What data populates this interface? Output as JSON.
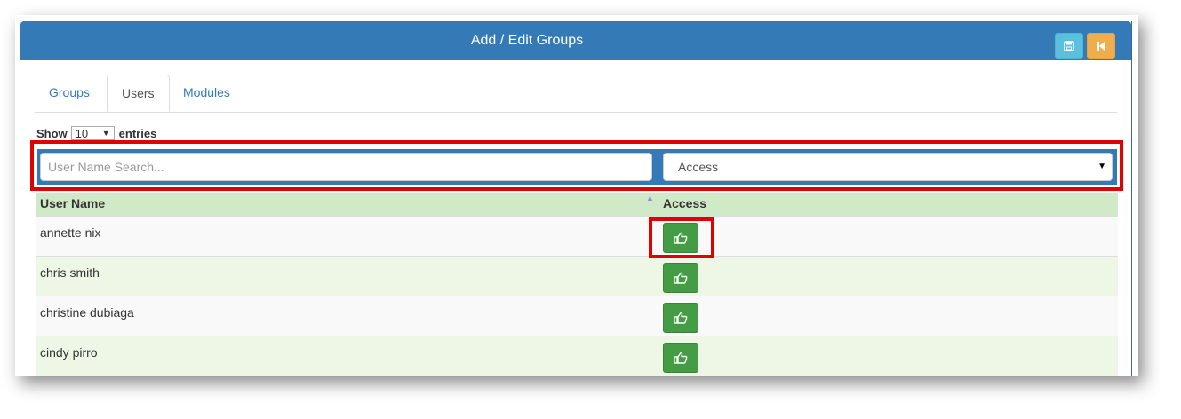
{
  "header": {
    "title": "Add / Edit Groups",
    "save_icon": "floppy-disk-icon",
    "back_icon": "step-backward-icon",
    "colors": {
      "header": "#337ab7",
      "save": "#5bc0de",
      "back": "#f0ad4e"
    }
  },
  "tabs": [
    {
      "label": "Groups",
      "active": false
    },
    {
      "label": "Users",
      "active": true
    },
    {
      "label": "Modules",
      "active": false
    }
  ],
  "length": {
    "show_label": "Show",
    "value": "10",
    "entries_label": "entries"
  },
  "filters": {
    "search_placeholder": "User Name Search...",
    "access_value": "Access"
  },
  "table": {
    "columns": [
      "User Name",
      "Access"
    ],
    "rows": [
      {
        "user": "annette nix",
        "access_icon": "thumbs-up-icon"
      },
      {
        "user": "chris smith",
        "access_icon": "thumbs-up-icon"
      },
      {
        "user": "christine dubiaga",
        "access_icon": "thumbs-up-icon"
      },
      {
        "user": "cindy pirro",
        "access_icon": "thumbs-up-icon"
      }
    ],
    "colors": {
      "header": "#d0e9c6",
      "access_button": "#449d44",
      "highlight": "#e00000"
    }
  }
}
